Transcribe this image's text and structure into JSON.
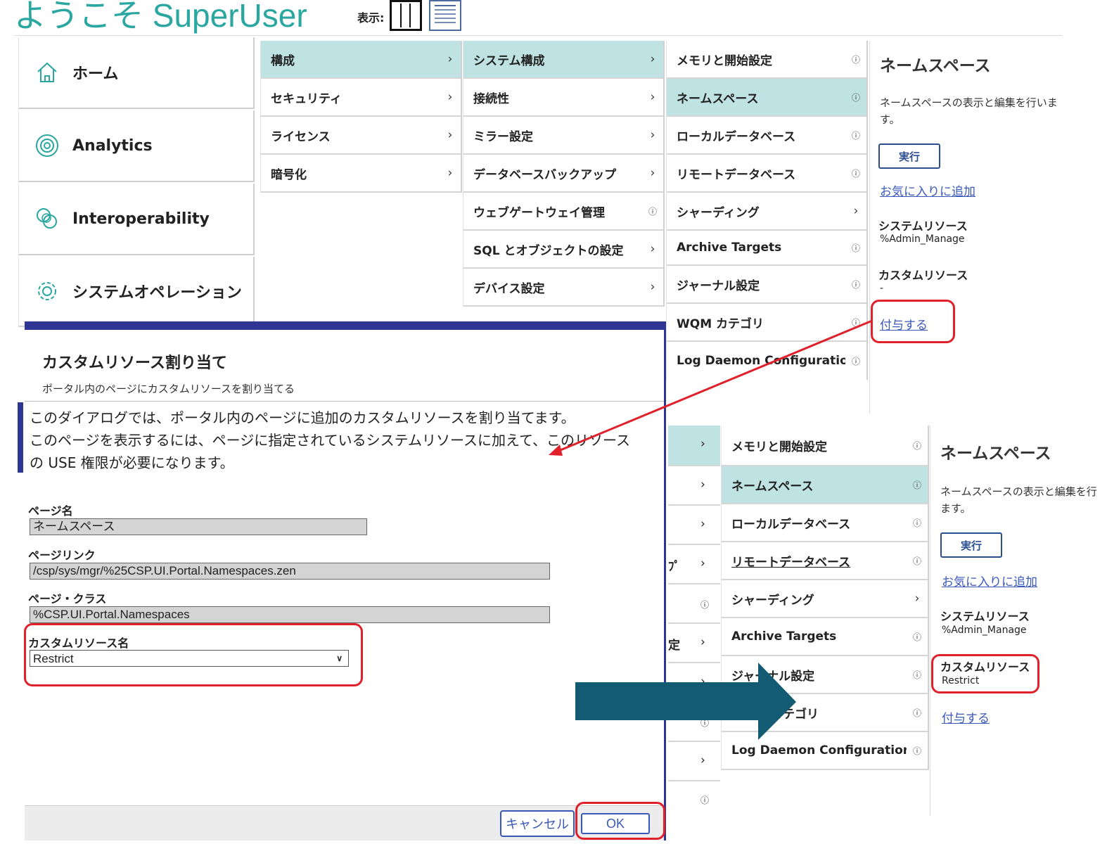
{
  "header": {
    "welcome": "ようこそ SuperUser",
    "view_label": "表示:"
  },
  "nav": {
    "items": [
      {
        "label": "ホーム",
        "icon": "home-icon"
      },
      {
        "label": "Analytics",
        "icon": "analytics-icon"
      },
      {
        "label": "Interoperability",
        "icon": "interoperability-icon"
      },
      {
        "label": "システムオペレーション",
        "icon": "gear-icon"
      }
    ]
  },
  "col1": {
    "items": [
      "構成",
      "セキュリティ",
      "ライセンス",
      "暗号化"
    ]
  },
  "col2": {
    "items": [
      "システム構成",
      "接続性",
      "ミラー設定",
      "データベースバックアップ",
      "ウェブゲートウェイ管理",
      "SQL とオブジェクトの設定",
      "デバイス設定"
    ]
  },
  "col3": {
    "items": [
      "メモリと開始設定",
      "ネームスペース",
      "ローカルデータベース",
      "リモートデータベース",
      "シャーディング",
      "Archive Targets",
      "ジャーナル設定",
      "WQM カテゴリ",
      "Log Daemon Configuration"
    ]
  },
  "detail": {
    "title": "ネームスペース",
    "desc": "ネームスペースの表示と編集を行います。",
    "desc_cut": "ネームスペースの表示と編集を行",
    "desc_end": "ます。",
    "exec": "実行",
    "fav": "お気に入りに追加",
    "sys_res_label": "システムリソース",
    "sys_res_value": "%Admin_Manage",
    "custom_res_label": "カスタムリソース",
    "custom_res_value_before": "-",
    "custom_res_value_after": "Restrict",
    "grant": "付与する"
  },
  "col2b": {
    "fragments": [
      "ﾌﾟ",
      "定"
    ]
  },
  "dialog": {
    "title": "カスタムリソース割り当て",
    "subtitle": "ポータル内のページにカスタムリソースを割り当てる",
    "note_line1": "このダイアログでは、ポータル内のページに追加のカスタムリソースを割り当てます。",
    "note_line2": "このページを表示するには、ページに指定されているシステムリソースに加えて、このリソース",
    "note_line3": "の USE 権限が必要になります。",
    "page_name_label": "ページ名",
    "page_name_value": "ネームスペース",
    "page_link_label": "ページリンク",
    "page_link_value": "/csp/sys/mgr/%25CSP.UI.Portal.Namespaces.zen",
    "page_class_label": "ページ・クラス",
    "page_class_value": "%CSP.UI.Portal.Namespaces",
    "custom_res_label": "カスタムリソース名",
    "custom_res_value": "Restrict",
    "cancel": "キャンセル",
    "ok": "OK"
  },
  "colors": {
    "accent": "#2aa7a0",
    "selected": "#bfe3e2",
    "dialog_bar": "#2e3592",
    "highlight": "#e0202a",
    "arrow": "#135b73"
  }
}
